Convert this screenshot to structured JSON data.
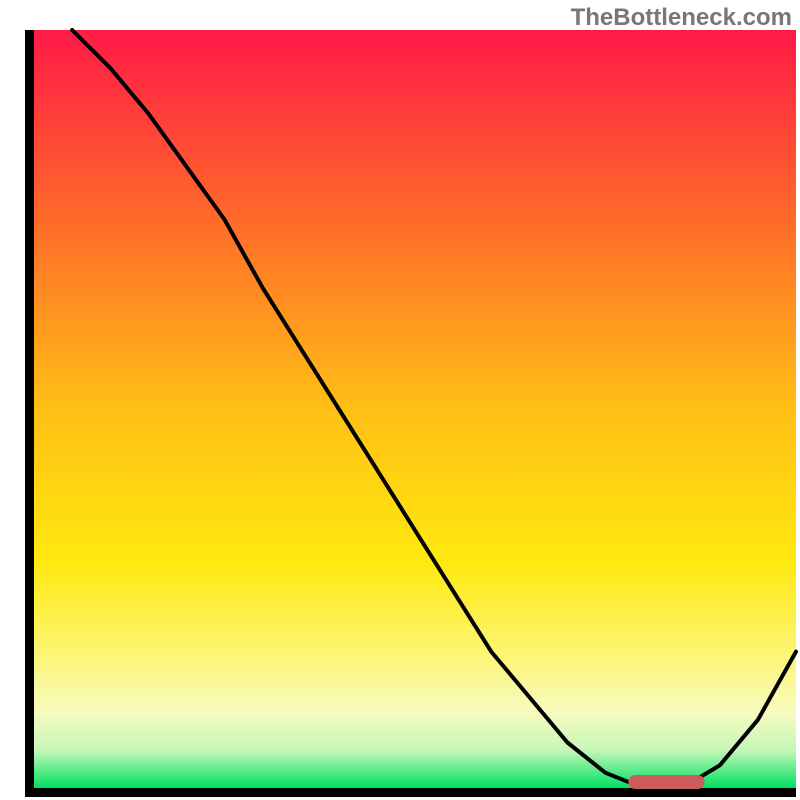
{
  "watermark": "TheBottleneck.com",
  "chart_data": {
    "type": "line",
    "title": "",
    "xlabel": "",
    "ylabel": "",
    "xlim": [
      0,
      100
    ],
    "ylim": [
      0,
      100
    ],
    "series": [
      {
        "name": "curve",
        "x": [
          5,
          10,
          15,
          20,
          25,
          30,
          35,
          40,
          45,
          50,
          55,
          60,
          65,
          70,
          75,
          80,
          85,
          90,
          95,
          100
        ],
        "y": [
          100,
          95,
          89,
          82,
          75,
          66,
          58,
          50,
          42,
          34,
          26,
          18,
          12,
          6,
          2,
          0,
          0,
          3,
          9,
          18
        ]
      }
    ],
    "marker": {
      "name": "sweet-spot",
      "x_start": 78,
      "x_end": 88,
      "y": 0
    },
    "gradient_stops": [
      {
        "offset": 0.0,
        "color": "#ff1a47"
      },
      {
        "offset": 0.25,
        "color": "#ff6a2a"
      },
      {
        "offset": 0.5,
        "color": "#ffc015"
      },
      {
        "offset": 0.7,
        "color": "#ffe80f"
      },
      {
        "offset": 0.82,
        "color": "#fdf570"
      },
      {
        "offset": 0.9,
        "color": "#f6fbbf"
      },
      {
        "offset": 0.95,
        "color": "#c6f7b8"
      },
      {
        "offset": 1.0,
        "color": "#00e062"
      }
    ]
  }
}
